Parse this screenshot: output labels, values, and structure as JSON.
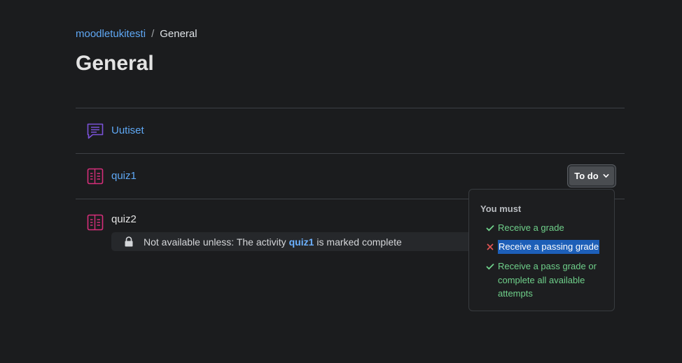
{
  "breadcrumb": {
    "course": "moodletukitesti",
    "separator": "/",
    "current": "General"
  },
  "page_title": "General",
  "activities": [
    {
      "name": "Uutiset",
      "icon": "forum-icon",
      "icon_color": "#7b52d9"
    },
    {
      "name": "quiz1",
      "icon": "quiz-icon",
      "icon_color": "#d62e7a"
    },
    {
      "name": "quiz2",
      "icon": "quiz-icon",
      "icon_color": "#d62e7a"
    }
  ],
  "restriction": {
    "prefix": "Not available unless: The activity",
    "link": "quiz1",
    "suffix": "is marked complete",
    "icon": "lock-icon"
  },
  "completion": {
    "button_label": "To do",
    "heading": "You must",
    "conditions": [
      {
        "text": "Receive a grade",
        "status": "done"
      },
      {
        "text": "Receive a passing grade",
        "status": "failed"
      },
      {
        "text": "Receive a pass grade or complete all available attempts",
        "status": "done"
      }
    ]
  },
  "colors": {
    "background": "#1b1c1e",
    "link": "#5fa8f5",
    "success": "#6fd08a",
    "failure": "#e05353",
    "selection": "#1d5fb8"
  }
}
